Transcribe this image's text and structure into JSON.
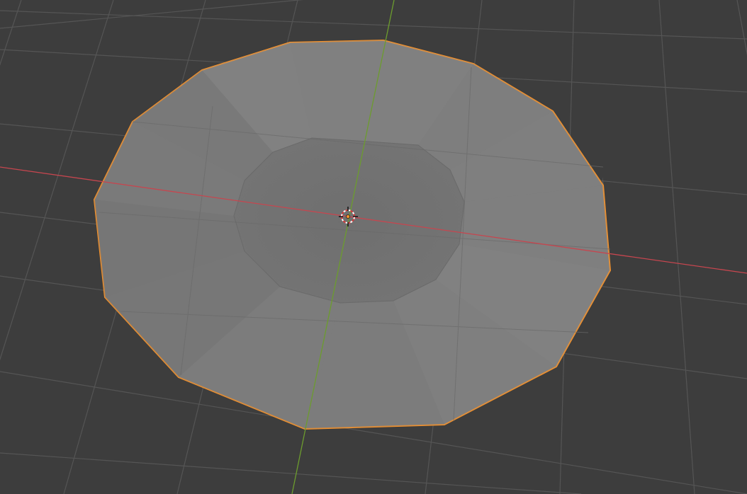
{
  "viewport": {
    "view": "3D Viewport",
    "shading": "solid",
    "selected_object": "mesh-disc",
    "selection_outline_color": "#f4922c",
    "background_color": "#3d3d3d",
    "grid_color": "#565656",
    "x_axis_color": "#c6464f",
    "y_axis_color": "#6c9c2e",
    "mesh_color": "#7e7e7e",
    "icons": [
      "3d-cursor-icon",
      "object-origin-icon"
    ]
  }
}
